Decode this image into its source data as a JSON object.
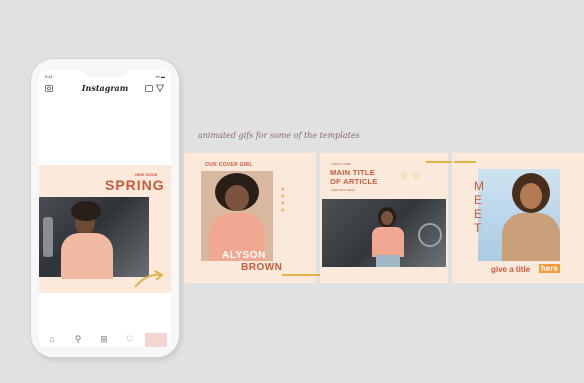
{
  "phone": {
    "status_time": "9:41",
    "status_icons": "▪▪▪ ▬",
    "app_name": "Instagram",
    "post": {
      "kicker": "NEW ISSUE",
      "title": "SPRING"
    }
  },
  "caption": "animated gifs for some of the templates",
  "tiles": {
    "tile1": {
      "heading": "OUR COVER GIRL",
      "name_first": "ALYSON",
      "name_last": "BROWN",
      "stars": "★\n★\n★\n★"
    },
    "tile2": {
      "kicker": "TODAYS VIBE",
      "title_line1": "MAIN TITLE",
      "title_line2": "OF ARTICLE",
      "subtext": "SUB TEXT HERE",
      "stars": "☆ ☆"
    },
    "tile3": {
      "vertical_word": "MEET",
      "footer_text": "give a title",
      "footer_highlight": "here"
    }
  },
  "colors": {
    "background": "#e1e1e1",
    "tile_bg": "#fbe9dc",
    "accent": "#c85a3c",
    "gold": "#e1b44a",
    "highlight": "#f59a3a"
  }
}
